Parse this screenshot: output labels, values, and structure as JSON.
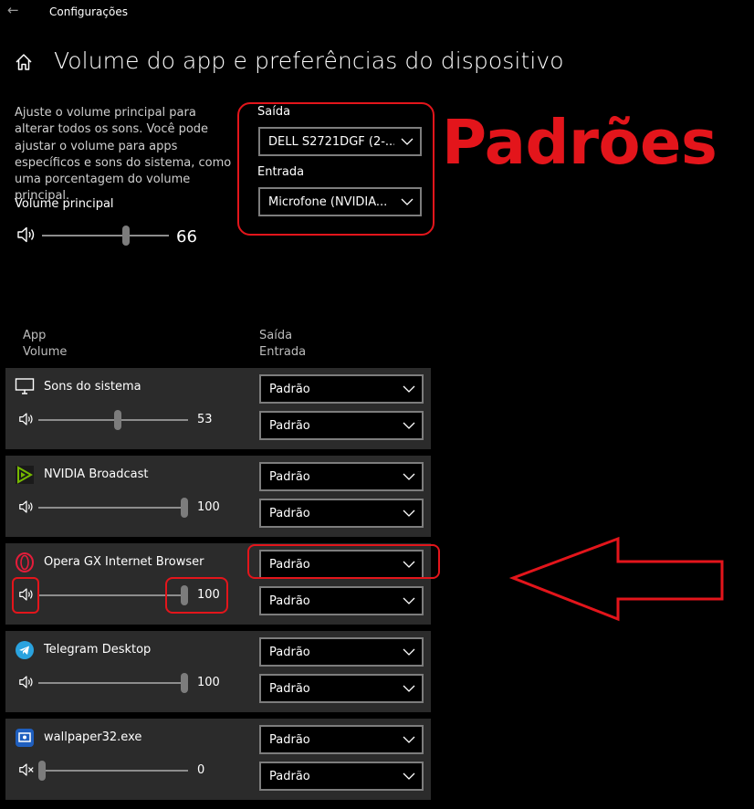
{
  "window": {
    "title": "Configurações"
  },
  "header": {
    "title": "Volume do app e preferências do dispositivo"
  },
  "main_volume": {
    "description": "Ajuste o volume principal para alterar todos os sons. Você pode ajustar o volume para apps específicos e sons do sistema, como uma porcentagem do volume principal.",
    "label": "Volume principal",
    "value": "66",
    "level_fraction": 0.66
  },
  "output": {
    "label": "Saída",
    "selected": "DELL S2721DGF (2-..."
  },
  "input": {
    "label": "Entrada",
    "selected": "Microfone (NVIDIA..."
  },
  "annotation": {
    "text": "Padrões",
    "color": "#e3151b"
  },
  "columns": {
    "app": "App",
    "volume": "Volume",
    "output": "Saída",
    "input": "Entrada"
  },
  "apps": [
    {
      "name": "Sons do sistema",
      "icon": "monitor-icon",
      "volume": "53",
      "level": 0.53,
      "output": "Padrão",
      "input": "Padrão",
      "muted": false
    },
    {
      "name": "NVIDIA Broadcast",
      "icon": "nvidia-broadcast-icon",
      "volume": "100",
      "level": 1.0,
      "output": "Padrão",
      "input": "Padrão",
      "muted": false
    },
    {
      "name": "Opera GX Internet Browser",
      "icon": "opera-gx-icon",
      "volume": "100",
      "level": 1.0,
      "output": "Padrão",
      "input": "Padrão",
      "muted": false
    },
    {
      "name": "Telegram Desktop",
      "icon": "telegram-icon",
      "volume": "100",
      "level": 1.0,
      "output": "Padrão",
      "input": "Padrão",
      "muted": false
    },
    {
      "name": "wallpaper32.exe",
      "icon": "wallpaper-engine-icon",
      "volume": "0",
      "level": 0.0,
      "output": "Padrão",
      "input": "Padrão",
      "muted": true
    }
  ]
}
